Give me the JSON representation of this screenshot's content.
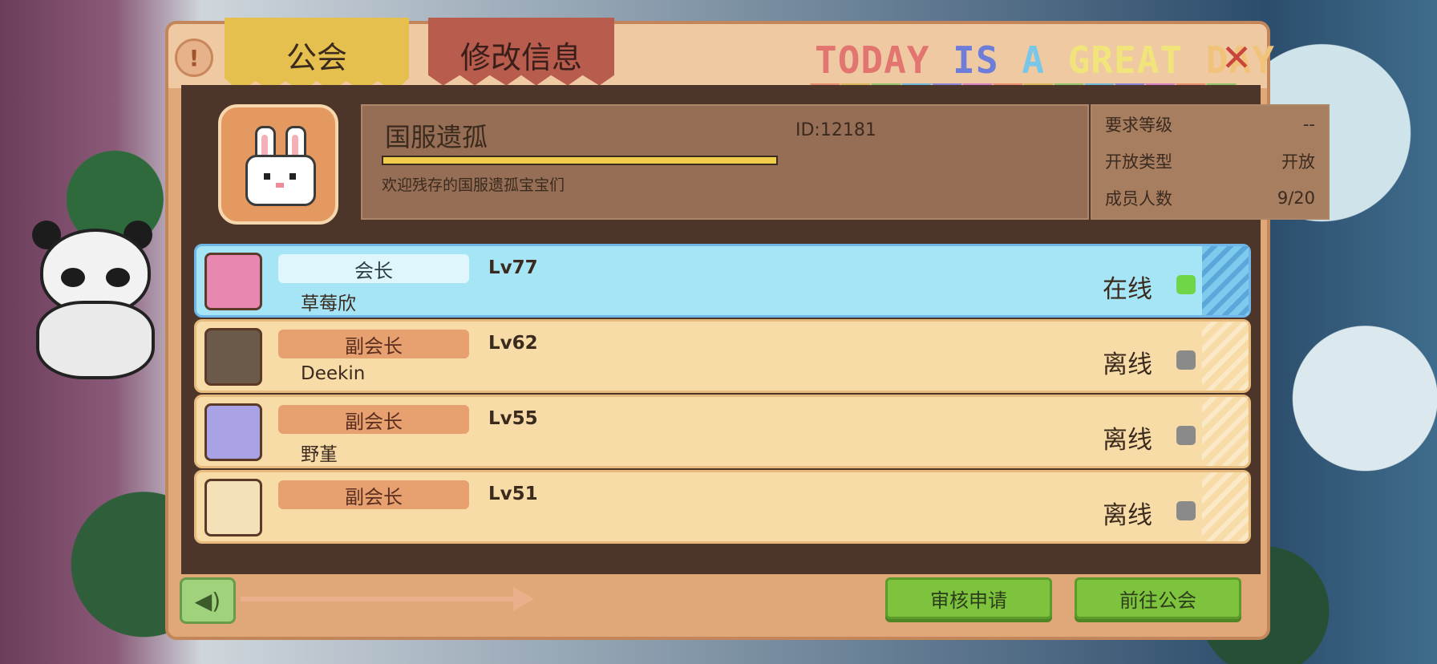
{
  "header": {
    "tabs": [
      {
        "label": "公会",
        "active": true
      },
      {
        "label": "修改信息",
        "active": false
      }
    ],
    "info_icon": "info-icon",
    "close_icon": "close-icon",
    "banner": [
      {
        "text": "TODAY",
        "color": "#e2756f"
      },
      {
        "text": "IS",
        "color": "#6e7ed8"
      },
      {
        "text": "A",
        "color": "#78c7e8"
      },
      {
        "text": "GREAT",
        "color": "#f0e47a"
      },
      {
        "text": "DAY",
        "color": "#f1c27a"
      }
    ],
    "pennant_colors": [
      "#e98b6d",
      "#d9b45a",
      "#8fc46a",
      "#6fb8d8",
      "#8d83d6",
      "#d57ec0",
      "#e98b6d",
      "#d9b45a",
      "#8fc46a",
      "#6fb8d8",
      "#8d83d6",
      "#d57ec0",
      "#e98b6d",
      "#8fc46a"
    ]
  },
  "guild": {
    "avatar_icon": "rabbit-icon",
    "name": "国服遗孤",
    "id_text": "ID:12181",
    "progress": 1.0,
    "description": "欢迎残存的国服遗孤宝宝们"
  },
  "stats": [
    {
      "label": "要求等级",
      "value": "--"
    },
    {
      "label": "开放类型",
      "value": "开放"
    },
    {
      "label": "成员人数",
      "value": "9/20"
    }
  ],
  "members": [
    {
      "role": "会长",
      "name": "草莓欣",
      "level": "Lv77",
      "status": "在线",
      "online": true,
      "avatar_color": "#e888b0"
    },
    {
      "role": "副会长",
      "name": "Deekin",
      "level": "Lv62",
      "status": "离线",
      "online": false,
      "avatar_color": "#6b5a4a"
    },
    {
      "role": "副会长",
      "name": "野堇",
      "level": "Lv55",
      "status": "离线",
      "online": false,
      "avatar_color": "#a9a3e6"
    },
    {
      "role": "副会长",
      "name": "",
      "level": "Lv51",
      "status": "离线",
      "online": false,
      "avatar_color": "#f4e1b8"
    }
  ],
  "colors": {
    "online_dot": "#6fd64a",
    "offline_dot": "#8a8a8a"
  },
  "footer": {
    "sound_icon": "speaker-icon",
    "review_label": "审核申请",
    "goto_label": "前往公会"
  }
}
